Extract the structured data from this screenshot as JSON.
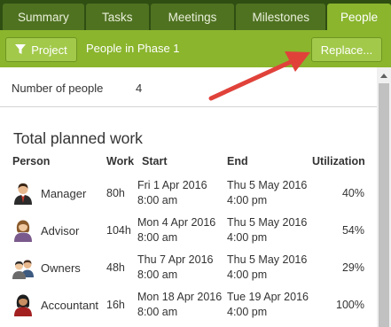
{
  "tabs": [
    {
      "label": "Summary",
      "active": false
    },
    {
      "label": "Tasks",
      "active": false
    },
    {
      "label": "Meetings",
      "active": false
    },
    {
      "label": "Milestones",
      "active": false
    },
    {
      "label": "People",
      "active": true
    }
  ],
  "toolbar": {
    "project_label": "Project",
    "project_icon": "filter-icon",
    "phase_label": "People in Phase 1",
    "replace_label": "Replace..."
  },
  "summary": {
    "count_label": "Number of people",
    "count_value": "4"
  },
  "planned_work": {
    "title": "Total planned work",
    "columns": {
      "person": "Person",
      "work": "Work",
      "start": "Start",
      "end": "End",
      "utilization": "Utilization"
    },
    "rows": [
      {
        "name": "Manager",
        "work": "80h",
        "start_date": "Fri 1 Apr 2016",
        "start_time": "8:00 am",
        "end_date": "Thu 5 May 2016",
        "end_time": "4:00 pm",
        "utilization": "40%",
        "avatar_icon": "person-tie-icon"
      },
      {
        "name": "Advisor",
        "work": "104h",
        "start_date": "Mon 4 Apr 2016",
        "start_time": "8:00 am",
        "end_date": "Thu 5 May 2016",
        "end_time": "4:00 pm",
        "utilization": "54%",
        "avatar_icon": "person-female-icon"
      },
      {
        "name": "Owners",
        "work": "48h",
        "start_date": "Thu 7 Apr 2016",
        "start_time": "8:00 am",
        "end_date": "Thu 5 May 2016",
        "end_time": "4:00 pm",
        "utilization": "29%",
        "avatar_icon": "group-icon"
      },
      {
        "name": "Accountant",
        "work": "16h",
        "start_date": "Mon 18 Apr 2016",
        "start_time": "8:00 am",
        "end_date": "Tue 19 Apr 2016",
        "end_time": "4:00 pm",
        "utilization": "100%",
        "avatar_icon": "person-female-dark-icon"
      }
    ]
  },
  "colors": {
    "tabbar": "#2f4e12",
    "tab": "#4f7221",
    "accent": "#8ab52d",
    "annotation_arrow": "#e0423a"
  }
}
